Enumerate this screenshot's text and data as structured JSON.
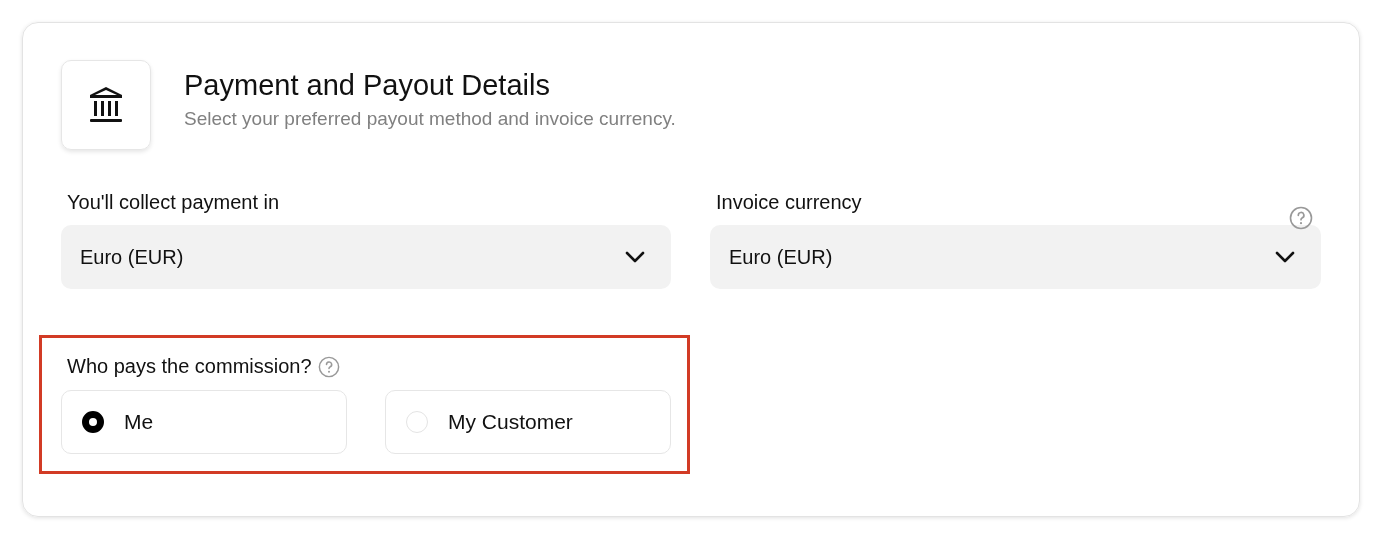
{
  "header": {
    "title": "Payment and Payout Details",
    "subtitle": "Select your preferred payout method and invoice currency."
  },
  "fields": [
    {
      "label": "You'll collect payment in",
      "value": "Euro (EUR)",
      "help": false
    },
    {
      "label": "Invoice currency",
      "value": "Euro (EUR)",
      "help": true
    }
  ],
  "commission": {
    "label": "Who pays the commission?",
    "highlighted": true,
    "options": [
      {
        "label": "Me",
        "selected": true
      },
      {
        "label": "My Customer",
        "selected": false
      }
    ]
  }
}
